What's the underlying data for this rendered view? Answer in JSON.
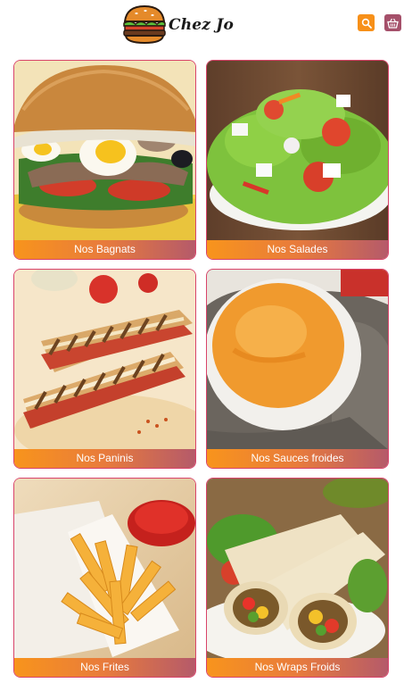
{
  "header": {
    "brand": "Chez Jo",
    "logo_icon": "burger-logo-icon",
    "search_icon": "search-icon",
    "cart_icon": "basket-icon",
    "colors": {
      "search": "#f79019",
      "cart": "#a5506a"
    }
  },
  "categories": [
    {
      "label": "Nos Bagnats",
      "image": "bagnat-sandwich-photo"
    },
    {
      "label": "Nos Salades",
      "image": "salad-bowl-photo"
    },
    {
      "label": "Nos Paninis",
      "image": "panini-photo"
    },
    {
      "label": "Nos Sauces froides",
      "image": "orange-sauce-photo"
    },
    {
      "label": "Nos Frites",
      "image": "fries-photo"
    },
    {
      "label": "Nos Wraps Froids",
      "image": "wraps-photo"
    }
  ],
  "colors": {
    "card_border": "#d9436a",
    "label_gradient_start": "#f8941c",
    "label_gradient_end": "#b55a6a"
  }
}
